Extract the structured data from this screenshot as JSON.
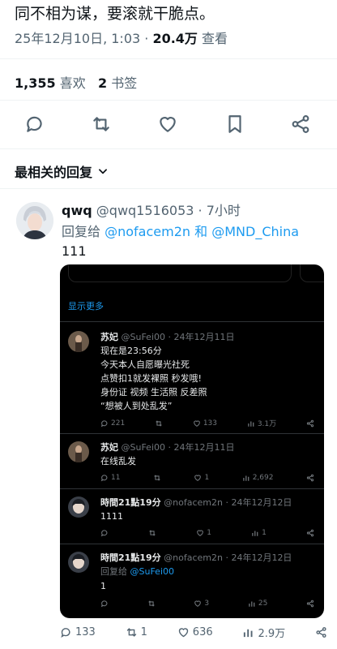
{
  "tweet": {
    "text": "同不相为谋，要滚就干脆点。",
    "timestamp": "25年12月10日, 1:03 · ",
    "views_count": "20.4万",
    "views_label": "查看",
    "likes_count": "1,355",
    "likes_label": "喜欢",
    "bookmarks_count": "2",
    "bookmarks_label": "书签"
  },
  "actions": [
    "reply-icon",
    "retweet-icon",
    "heart-icon",
    "bookmark-icon",
    "share-icon"
  ],
  "sort": {
    "label": "最相关的回复"
  },
  "reply": {
    "name": "qwq",
    "handle": "@qwq1516053",
    "time": "· 7小时",
    "replying_prefix": "回复给",
    "mention_1": "@nofacem2n",
    "and": "和",
    "mention_2": "@MND_China",
    "text": "111",
    "stats": {
      "replies": "133",
      "retweets": "1",
      "likes": "636",
      "views": "2.9万"
    }
  },
  "embedded": {
    "show_more": "显示更多",
    "posts": [
      {
        "name": "苏妃",
        "handle": "@SuFei00",
        "date": "· 24年12月11日",
        "lines": [
          "现在是23:56分",
          "今天本人自愿曝光社死",
          "点赞扣1就发裸照 秒发哦!",
          "身份证  视频 生活照 反差照",
          "“想被人到处乱发”"
        ],
        "replies": "221",
        "retweets": "",
        "likes": "133",
        "views": "3.1万"
      },
      {
        "name": "苏妃",
        "handle": "@SuFei00",
        "date": "· 24年12月11日",
        "lines": [
          "在线乱发"
        ],
        "replies": "11",
        "retweets": "",
        "likes": "1",
        "views": "2,692"
      },
      {
        "name": "時間21點19分",
        "handle": "@nofacem2n",
        "date": "· 24年12月12日",
        "lines": [
          "1111"
        ],
        "replies": "",
        "retweets": "",
        "likes": "1",
        "views": "1"
      },
      {
        "name": "時間21點19分",
        "handle": "@nofacem2n",
        "date": "· 24年12月12日",
        "replying_prefix": "回复给",
        "replying_to": "@SuFei00",
        "lines": [
          "1"
        ],
        "replies": "",
        "retweets": "",
        "likes": "3",
        "views": "25"
      }
    ]
  },
  "colors": {
    "accent": "#1d9bf0",
    "muted": "#536471",
    "dark_bg": "#000000"
  }
}
